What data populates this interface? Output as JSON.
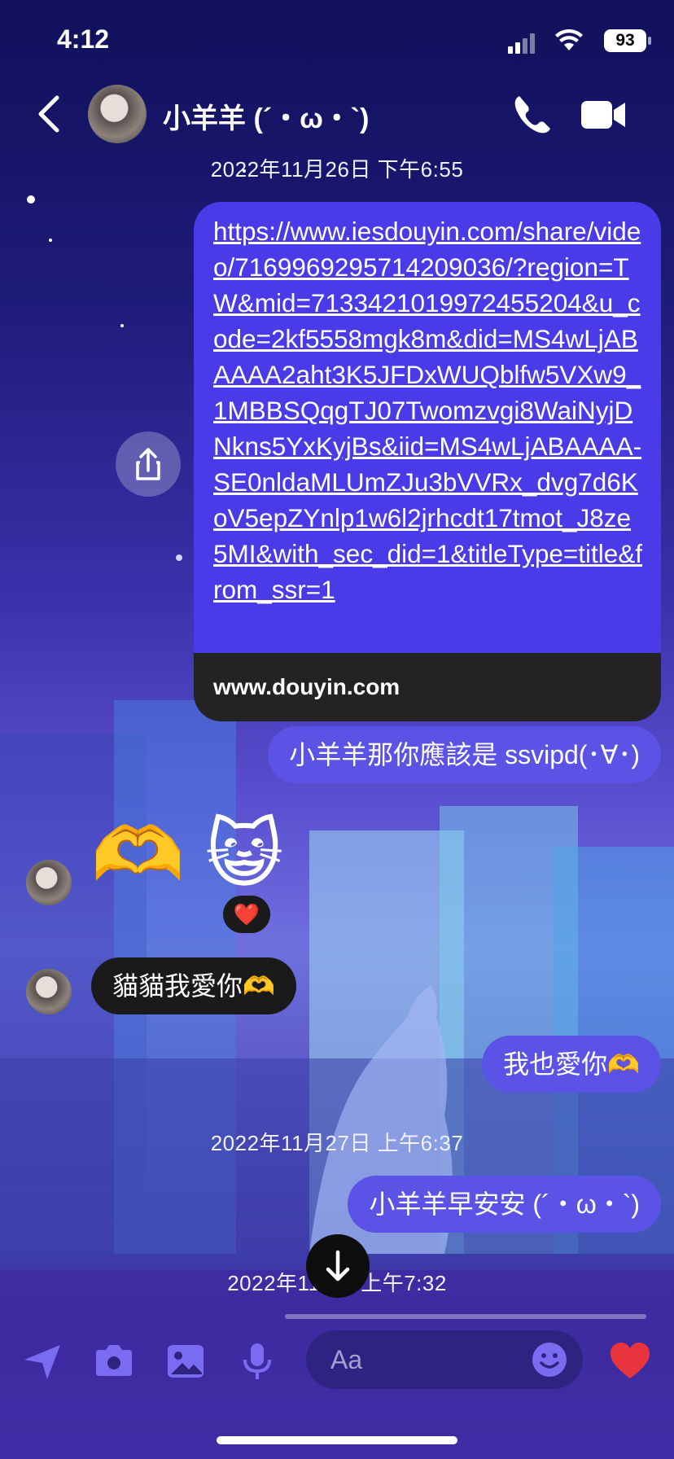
{
  "status_bar": {
    "time": "4:12",
    "battery": "93"
  },
  "header": {
    "contact_name": "小羊羊 (´・ω・`)"
  },
  "timestamps": [
    "2022年11月26日 下午6:55",
    "2022年11月27日 上午6:37",
    "2022年11/   日 上午7:32"
  ],
  "link_message": {
    "url": "https://www.iesdouyin.com/share/video/7169969295714209036/?region=TW&mid=7133421019972455204&u_code=2kf5558mgk8m&did=MS4wLjABAAAA2aht3K5JFDxWUQblfw5VXw9_1MBBSQqgTJ07Twomzvgi8WaiNyjDNkns5YxKyjBs&iid=MS4wLjABAAAA-SE0nldaMLUmZJu3bVVRx_dvg7d6KoV5epZYnlp1w6l2jrhcdt17tmot_J8ze5MI&with_sec_did=1&titleType=title&from_ssr=1",
    "domain": "www.douyin.com"
  },
  "messages": {
    "out_1": "小羊羊那你應該是 ssvipd(･∀･)",
    "in_emoji": "🫶 😺",
    "reaction": "❤️",
    "in_1": "貓貓我愛你🫶",
    "out_2": "我也愛你🫶",
    "out_3": "小羊羊早安安 (´・ω・`)"
  },
  "composer": {
    "placeholder": "Aa"
  },
  "icons": {
    "back": "chevron-left-icon",
    "call": "phone-icon",
    "video": "video-camera-icon",
    "share": "share-icon",
    "scroll": "arrow-down-icon",
    "location": "location-arrow-icon",
    "camera": "camera-icon",
    "gallery": "photo-icon",
    "mic": "microphone-icon",
    "emoji": "smiley-icon",
    "like": "heart-icon"
  },
  "colors": {
    "outgoing_bubble": "#5b52e6",
    "link_bubble": "#4a3be8",
    "incoming_bubble": "#1a1a1a",
    "heart": "#e8343c"
  }
}
